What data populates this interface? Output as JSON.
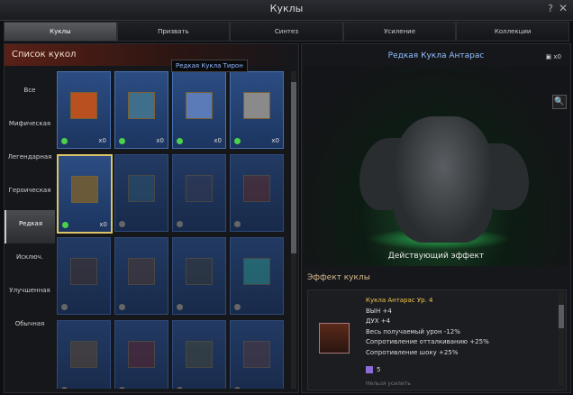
{
  "window": {
    "title": "Куклы",
    "help_label": "?",
    "close_label": "✕"
  },
  "tabs": [
    {
      "label": "Куклы",
      "active": true
    },
    {
      "label": "Призвать"
    },
    {
      "label": "Синтез"
    },
    {
      "label": "Усиление"
    },
    {
      "label": "Коллекции"
    }
  ],
  "list": {
    "header": "Список кукол",
    "categories": [
      "Все",
      "Мифическая",
      "Легендарная",
      "Героическая",
      "Редкая",
      "Исключ.",
      "Улучшенная",
      "Обычная"
    ],
    "active_category": "Редкая",
    "tooltip": "Редкая Кукла Тирон"
  },
  "cards": [
    {
      "count": "x0",
      "owned": true,
      "color": "#b8501f"
    },
    {
      "count": "x0",
      "owned": true,
      "color": "#3f6f8a"
    },
    {
      "count": "x0",
      "owned": true,
      "color": "#5a7bb8"
    },
    {
      "count": "x0",
      "owned": true,
      "color": "#8a8a8a"
    },
    {
      "count": "x0",
      "owned": true,
      "selected": true,
      "color": "#6b5a3a"
    },
    {
      "count": "",
      "owned": false,
      "color": "#2f5a70"
    },
    {
      "count": "",
      "owned": false,
      "color": "#3a3a50"
    },
    {
      "count": "",
      "owned": false,
      "color": "#6a2a20"
    },
    {
      "count": "",
      "owned": false,
      "color": "#4a3020"
    },
    {
      "count": "",
      "owned": false,
      "color": "#5a3a2a"
    },
    {
      "count": "",
      "owned": false,
      "color": "#3a3a30"
    },
    {
      "count": "",
      "owned": false,
      "color": "#2fa090"
    },
    {
      "count": "",
      "owned": false,
      "color": "#6a4a2a"
    },
    {
      "count": "",
      "owned": false,
      "color": "#6a2020"
    },
    {
      "count": "",
      "owned": false,
      "color": "#4a4a30"
    },
    {
      "count": "",
      "owned": false,
      "color": "#5a3a3a"
    }
  ],
  "detail": {
    "title": "Редкая Кукла Антарас",
    "box_count": "x0",
    "magnify_icon": "🔍",
    "effect_label": "Действующий эффект",
    "effect_title": "Эффект куклы",
    "stats": {
      "name": "Кукла Антарас Ур. 4",
      "lines": [
        "ВЫН +4",
        "ДУХ +4",
        "Весь получаемый урон -12%",
        "Сопротивление отталкиванию +25%",
        "Сопротивление шоку +25%"
      ]
    },
    "stones": "5",
    "cannot_enhance": "Нельзя усилить"
  }
}
